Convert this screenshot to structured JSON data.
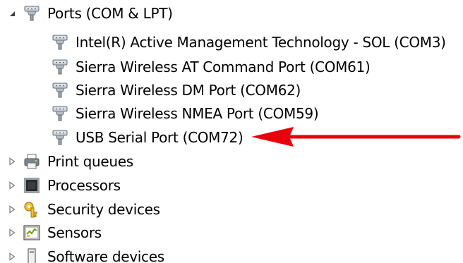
{
  "device_tree": {
    "ports": {
      "label": "Ports (COM & LPT)",
      "icon": "port-connector-icon",
      "expanded": true,
      "children": [
        {
          "label": "Intel(R) Active Management Technology - SOL (COM3)",
          "icon": "port-connector-icon"
        },
        {
          "label": "Sierra Wireless AT Command Port (COM61)",
          "icon": "port-connector-icon"
        },
        {
          "label": "Sierra Wireless DM Port (COM62)",
          "icon": "port-connector-icon"
        },
        {
          "label": "Sierra Wireless NMEA Port (COM59)",
          "icon": "port-connector-icon"
        },
        {
          "label": "USB Serial Port (COM72)",
          "icon": "port-connector-icon"
        }
      ]
    },
    "categories": [
      {
        "label": "Print queues",
        "icon": "printer-icon",
        "expanded": false
      },
      {
        "label": "Processors",
        "icon": "processor-chip-icon",
        "expanded": false
      },
      {
        "label": "Security devices",
        "icon": "key-lock-icon",
        "expanded": false
      },
      {
        "label": "Sensors",
        "icon": "sensor-icon",
        "expanded": false
      },
      {
        "label": "Software devices",
        "icon": "software-device-icon",
        "expanded": false
      }
    ]
  },
  "annotation": {
    "arrow_color": "#e8000b",
    "points_to": "USB Serial Port (COM72)"
  }
}
